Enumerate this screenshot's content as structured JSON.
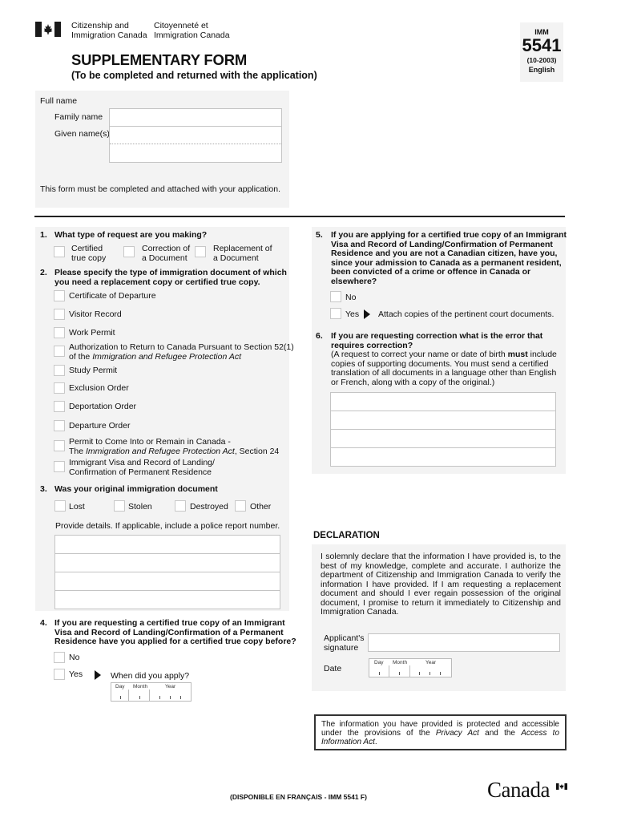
{
  "header": {
    "dept_en_line1": "Citizenship and",
    "dept_en_line2": "Immigration Canada",
    "dept_fr_line1": "Citoyenneté et",
    "dept_fr_line2": "Immigration Canada",
    "title": "SUPPLEMENTARY FORM",
    "subtitle": "(To be completed and returned with the application)",
    "form_prefix": "IMM",
    "form_number": "5541",
    "form_version": "(10-2003)",
    "form_language": "English"
  },
  "full_name": {
    "label": "Full name",
    "family_name_label": "Family name",
    "given_names_label": "Given name(s)",
    "family_name_value": "",
    "given_names_value": "",
    "notice": "This form must be completed and attached with your application."
  },
  "q1": {
    "number": "1.",
    "question": "What type of request are you making?",
    "options": [
      {
        "line1": "Certified",
        "line2": "true copy"
      },
      {
        "line1": "Correction of",
        "line2": "a Document"
      },
      {
        "line1": "Replacement of",
        "line2": "a Document"
      }
    ]
  },
  "q2": {
    "number": "2.",
    "question_line1": "Please specify the type of immigration document of which",
    "question_line2": "you need a replacement copy or certified true copy.",
    "options": [
      {
        "line1": "Certificate of Departure"
      },
      {
        "line1": "Visitor Record"
      },
      {
        "line1": "Work Permit"
      },
      {
        "line1": "Authorization to Return to Canada Pursuant to Section 52(1)",
        "line2_pre": "of the ",
        "line2_italic": "Immigration and Refugee Protection Act",
        "line2_post": ""
      },
      {
        "line1": "Study Permit"
      },
      {
        "line1": "Exclusion Order"
      },
      {
        "line1": "Deportation Order"
      },
      {
        "line1": "Departure Order"
      },
      {
        "line1": "Permit to Come Into or Remain in Canada -",
        "line2_pre": "The ",
        "line2_italic": "Immigration and Refugee Protection Act",
        "line2_post": ", Section 24"
      },
      {
        "line1": "Immigrant Visa and Record of Landing/",
        "line2_pre": "Confirmation of Permanent Residence",
        "line2_italic": "",
        "line2_post": ""
      }
    ]
  },
  "q3": {
    "number": "3.",
    "question": "Was your original immigration document",
    "options": [
      "Lost",
      "Stolen",
      "Destroyed",
      "Other"
    ],
    "details_label": "Provide details. If applicable, include a police report number."
  },
  "q4": {
    "number": "4.",
    "question_line1": "If you are requesting a certified true copy of an Immigrant",
    "question_line2": "Visa and Record of Landing/Confirmation of a Permanent",
    "question_line3": "Residence have you applied for a certified true copy before?",
    "no_label": "No",
    "yes_label": "Yes",
    "when_label": "When did you apply?",
    "date_labels": {
      "day": "Day",
      "month": "Month",
      "year": "Year"
    }
  },
  "q5": {
    "number": "5.",
    "question_lines": [
      "If you are applying for a certified true copy of an Immigrant",
      "Visa and Record of Landing/Confirmation of Permanent",
      "Residence and you are not a Canadian citizen, have you,",
      "since your admission to Canada as a permanent resident,",
      "been convicted of a crime or offence in Canada or",
      "elsewhere?"
    ],
    "no_label": "No",
    "yes_label": "Yes",
    "yes_instruction": "Attach copies of the pertinent court documents."
  },
  "q6": {
    "number": "6.",
    "question_line1": "If you are requesting correction what is the error that",
    "question_line2": "requires correction?",
    "note_line1_pre": "(A request to correct your name or date of birth ",
    "note_line1_bold": "must",
    "note_line1_post": " include",
    "note_line2": "copies of supporting documents. You must send a certified",
    "note_line3": "translation of all documents in a language other than English",
    "note_line4": "or French, along with a copy of the original.)"
  },
  "declaration": {
    "title": "DECLARATION",
    "text": "I solemnly declare that the information I have provided is, to the best of my knowledge, complete and accurate. I authorize the department of Citizenship and Immigration Canada to verify the information I have provided. If I am requesting a replacement document and should I ever regain possession of the original document, I promise to return it immediately to Citizenship and Immigration Canada.",
    "signature_label_line1": "Applicant's",
    "signature_label_line2": "signature",
    "date_label": "Date",
    "date_labels": {
      "day": "Day",
      "month": "Month",
      "year": "Year"
    }
  },
  "privacy": {
    "pre": "The information you have provided is protected and accessible under the provisions of the ",
    "act1": "Privacy Act",
    "mid": " and the ",
    "act2": "Access to Information Act",
    "post": "."
  },
  "footer": {
    "french_notice": "(DISPONIBLE EN FRANÇAIS - IMM 5541 F)",
    "wordmark": "Canada"
  }
}
